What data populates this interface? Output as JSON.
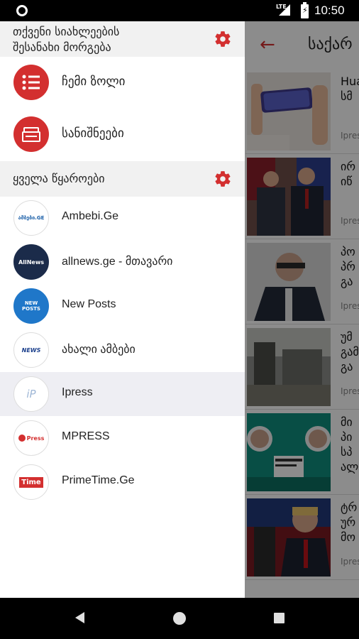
{
  "status_bar": {
    "network": "LTE",
    "time": "10:50"
  },
  "background": {
    "title": "საქარ",
    "articles": [
      {
        "line1": "Hua",
        "line2": "სმ",
        "line3": "",
        "source": "Ipres"
      },
      {
        "line1": "ირ",
        "line2": "იწ",
        "line3": "",
        "source": "Ipres"
      },
      {
        "line1": "პო",
        "line2": "პრ",
        "line3": "გა",
        "source": "Ipres"
      },
      {
        "line1": "უმ",
        "line2": "გამ",
        "line3": "გა",
        "source": "Ipres"
      },
      {
        "line1": "მი",
        "line2": "პი",
        "line3": "სპ",
        "line4": "ალ",
        "source": "Ipres"
      },
      {
        "line1": "ტრ",
        "line2": "ურ",
        "line3": "მო",
        "source": "Ipres"
      }
    ]
  },
  "drawer": {
    "header1": {
      "line1": "თქვენი სიახლეების",
      "line2": "შესანახი მორგება"
    },
    "menu": [
      {
        "label": "ჩემი ზოლი",
        "icon": "list-icon"
      },
      {
        "label": "სანიშნეები",
        "icon": "bookmarks-icon"
      }
    ],
    "header2": {
      "label": "ყველა წყაროები"
    },
    "sources": [
      {
        "label": "Ambebi.Ge",
        "logo_text": "ამბები.GE",
        "logo_color": "#1a5fa8",
        "logo_bg": "#ffffff"
      },
      {
        "label": "allnews.ge - მთავარი",
        "logo_text": "AllNews",
        "logo_color": "#ffffff",
        "logo_bg": "#1b2b4a"
      },
      {
        "label": "New Posts",
        "logo_text": "NEW POSTS",
        "logo_color": "#ffffff",
        "logo_bg": "#1f77c9"
      },
      {
        "label": "ახალი ამბები",
        "logo_text": "NEWS",
        "logo_color": "#1a3f8c",
        "logo_bg": "#ffffff"
      },
      {
        "label": "Ipress",
        "logo_text": "iP",
        "logo_color": "#9fb7d6",
        "logo_bg": "#ffffff",
        "selected": true
      },
      {
        "label": "MPRESS",
        "logo_text": "Press",
        "logo_color": "#d32f2f",
        "logo_bg": "#ffffff"
      },
      {
        "label": "PrimeTime.Ge",
        "logo_text": "Time",
        "logo_color": "#ffffff",
        "logo_bg": "#d32f2f"
      }
    ]
  },
  "colors": {
    "accent": "#d32f2f",
    "section_bg": "#f1f1f1",
    "selected_bg": "#eeeef3"
  }
}
